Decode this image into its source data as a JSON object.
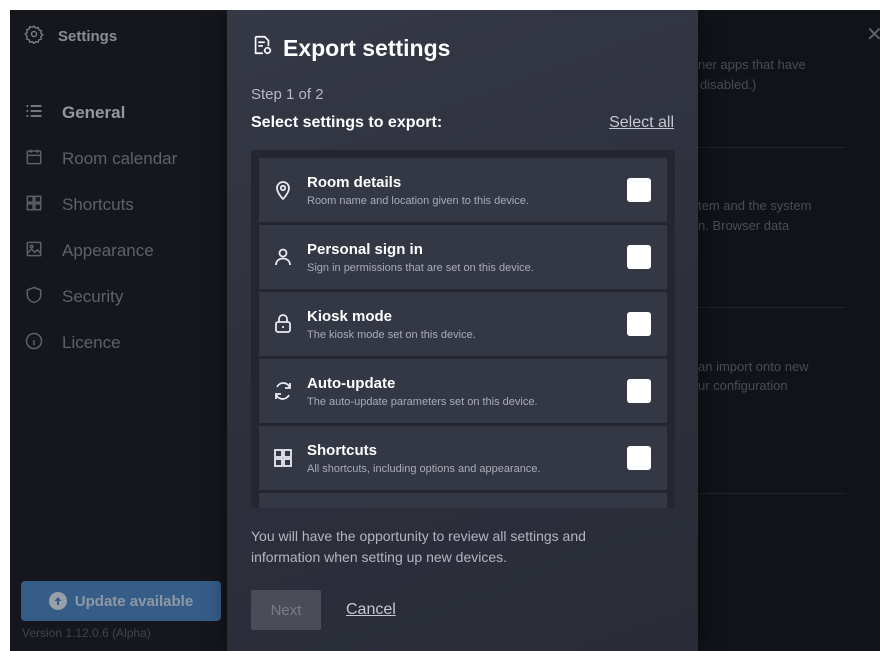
{
  "sidebar": {
    "title": "Settings",
    "items": [
      {
        "label": "General",
        "icon": "list-icon",
        "active": true
      },
      {
        "label": "Room calendar",
        "icon": "calendar-icon"
      },
      {
        "label": "Shortcuts",
        "icon": "grid-icon"
      },
      {
        "label": "Appearance",
        "icon": "image-icon"
      },
      {
        "label": "Security",
        "icon": "shield-icon"
      },
      {
        "label": "Licence",
        "icon": "info-icon"
      }
    ],
    "update_label": "Update available",
    "version": "Version 1.12.0.6 (Alpha)"
  },
  "background": {
    "text1_line1": "ner apps that have",
    "text1_line2": "disabled.)",
    "text2_line1": "tem and the system",
    "text2_line2": "n. Browser data",
    "text3_line1": "an import onto new",
    "text3_line2": "ur configuration"
  },
  "dialog": {
    "title": "Export settings",
    "step": "Step 1 of 2",
    "subtitle": "Select settings to export:",
    "select_all": "Select all",
    "items": [
      {
        "title": "Room details",
        "desc": "Room name and location given to this device.",
        "icon": "location-pin-icon"
      },
      {
        "title": "Personal sign in",
        "desc": "Sign in permissions that are set on this device.",
        "icon": "person-icon"
      },
      {
        "title": "Kiosk mode",
        "desc": "The kiosk mode set on this device.",
        "icon": "lock-icon"
      },
      {
        "title": "Auto-update",
        "desc": "The auto-update parameters set on this device.",
        "icon": "refresh-icon"
      },
      {
        "title": "Shortcuts",
        "desc": "All shortcuts, including options and appearance.",
        "icon": "grid-icon"
      }
    ],
    "note": "You will have the opportunity to review all settings and information when setting up new devices.",
    "next_label": "Next",
    "cancel_label": "Cancel"
  },
  "colors": {
    "accent": "#4d89c9",
    "dialog_bg": "#333643",
    "app_bg": "#15171e"
  }
}
